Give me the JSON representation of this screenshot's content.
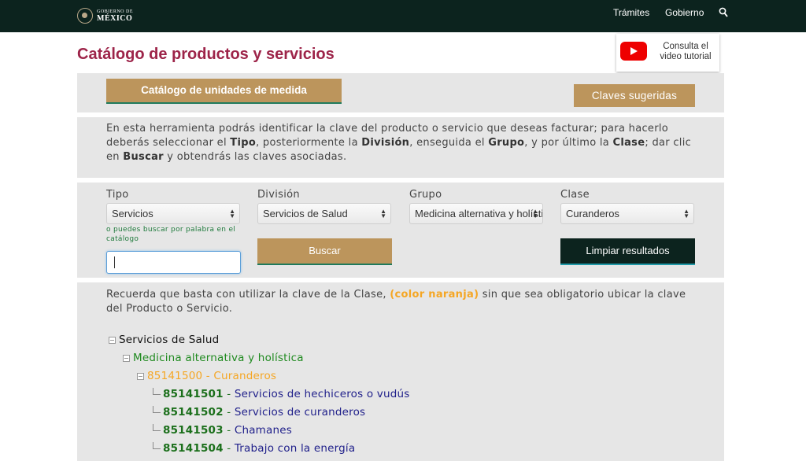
{
  "navbar": {
    "logo_line1": "GOBIERNO DE",
    "logo_line2": "MÉXICO",
    "links": [
      "Trámites",
      "Gobierno"
    ],
    "search_icon": "search-icon"
  },
  "page_title": "Catálogo de productos y servicios",
  "video_button": {
    "label": "Consulta el video tutorial",
    "icon": "youtube-icon"
  },
  "buttons": {
    "units": "Catálogo de unidades de medida",
    "suggested": "Claves sugeridas",
    "search": "Buscar",
    "clear": "Limpiar resultados"
  },
  "intro": {
    "p1": "En esta herramienta podrás identificar la clave del producto o servicio que deseas facturar; para hacerlo deberás seleccionar el ",
    "tipo": "Tipo",
    "p2": ", posteriormente la ",
    "division": "División",
    "p3": ", enseguida el ",
    "grupo": "Grupo",
    "p4": ", y por último la ",
    "clase": "Clase",
    "p5": "; dar clic en ",
    "buscar": "Buscar",
    "p6": " y obtendrás las claves asociadas."
  },
  "filters": {
    "tipo": {
      "label": "Tipo",
      "value": "Servicios"
    },
    "division": {
      "label": "División",
      "value": "Servicios de Salud"
    },
    "grupo": {
      "label": "Grupo",
      "value": "Medicina alternativa y holística"
    },
    "clase": {
      "label": "Clase",
      "value": "Curanderos"
    },
    "hint": "o puedes buscar por palabra en el catálogo",
    "search_value": ""
  },
  "reminder": {
    "p1": "Recuerda que basta con utilizar la clave de la Clase, ",
    "highlight": "(color naranja)",
    "p2": " sin que sea obligatorio ubicar la clave del Producto o Servicio."
  },
  "tree": {
    "division": "Servicios de Salud",
    "group": "Medicina alternativa y holística",
    "class": "85141500 - Curanderos",
    "products": [
      {
        "code": "85141501",
        "desc": "Servicios de hechiceros o vudús"
      },
      {
        "code": "85141502",
        "desc": "Servicios de curanderos"
      },
      {
        "code": "85141503",
        "desc": "Chamanes"
      },
      {
        "code": "85141504",
        "desc": "Trabajo con la energía"
      }
    ]
  },
  "colors": {
    "navbar": "#0c231e",
    "title": "#9d2449",
    "gold": "#bc955c",
    "panel": "#e6e6e6",
    "class_orange": "#f5a623",
    "code_green": "#1b6f1b",
    "desc_blue": "#1f1f8a"
  }
}
